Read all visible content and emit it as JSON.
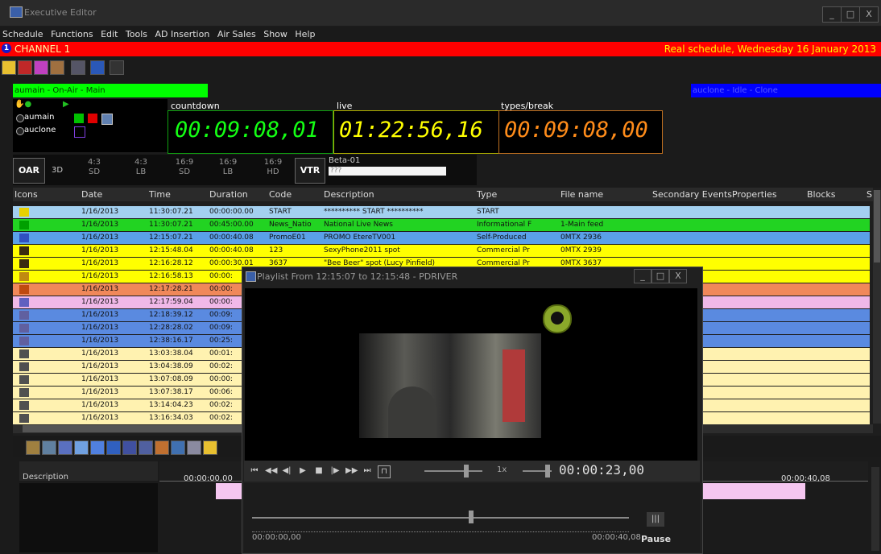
{
  "window": {
    "title": "Executive Editor",
    "min": "_",
    "max": "□",
    "close": "X"
  },
  "menu": [
    "Schedule",
    "Functions",
    "Edit",
    "Tools",
    "AD Insertion",
    "Air Sales",
    "Show",
    "Help"
  ],
  "channel": {
    "number": "1",
    "name": "CHANNEL 1",
    "status": "Real schedule, Wednesday 16 January 2013"
  },
  "servers": {
    "onair": "aumain - On-Air - Main",
    "backup": "auclone - Idle - Clone",
    "items": [
      "aumain",
      "auclone"
    ]
  },
  "clocks": {
    "countdown_label": "countdown",
    "countdown": "00:09:08,01",
    "live_label": "live",
    "live": "01:22:56,16",
    "types_label": "types/break",
    "types": "00:09:08,00"
  },
  "modes": {
    "oar": "OAR",
    "three_d": "3D",
    "m1": "4:3",
    "m1s": "SD",
    "m2": "4:3",
    "m2s": "LB",
    "m3": "16:9",
    "m3s": "SD",
    "m4": "16:9",
    "m4s": "LB",
    "m5": "16:9",
    "m5s": "HD",
    "vtr": "VTR",
    "beta": "Beta-01",
    "beta_field": "???"
  },
  "columns": [
    "Icons",
    "Date",
    "Time",
    "Duration",
    "Code",
    "Description",
    "Type",
    "File name",
    "Secondary Events",
    "Properties",
    "Blocks",
    "S"
  ],
  "rows": [
    {
      "date": "1/16/2013",
      "time": "11:30:07.21",
      "dur": "00:00:00.00",
      "code": "START",
      "desc": "********** START **********",
      "type": "START",
      "file": "",
      "bg": "#a3d0f0"
    },
    {
      "date": "1/16/2013",
      "time": "11:30:07.21",
      "dur": "00:45:00.00",
      "code": "News_Natio",
      "desc": "National Live News",
      "type": "Informational F",
      "file": "1-Main feed",
      "bg": "#22d322"
    },
    {
      "date": "1/16/2013",
      "time": "12:15:07.21",
      "dur": "00:00:40.08",
      "code": "PromoE01",
      "desc": "PROMO EtereTV001",
      "type": "Self-Produced",
      "file": "0MTX    2936",
      "bg": "#5aa0e8"
    },
    {
      "date": "1/16/2013",
      "time": "12:15:48.04",
      "dur": "00:00:40.08",
      "code": "123",
      "desc": "SexyPhone2011 spot",
      "type": "Commercial Pr",
      "file": "0MTX    2939",
      "bg": "#ffff00"
    },
    {
      "date": "1/16/2013",
      "time": "12:16:28.12",
      "dur": "00:00:30.01",
      "code": "3637",
      "desc": "\"Bee Beer\" spot (Lucy Pinfield)",
      "type": "Commercial Pr",
      "file": "0MTX    3637",
      "bg": "#ffff00"
    },
    {
      "date": "1/16/2013",
      "time": "12:16:58.13",
      "dur": "00:00:",
      "code": "",
      "desc": "",
      "type": "",
      "file": "",
      "bg": "#ffff00"
    },
    {
      "date": "1/16/2013",
      "time": "12:17:28.21",
      "dur": "00:00:",
      "code": "",
      "desc": "",
      "type": "",
      "file": "",
      "bg": "#f0885a"
    },
    {
      "date": "1/16/2013",
      "time": "12:17:59.04",
      "dur": "00:00:",
      "code": "",
      "desc": "",
      "type": "",
      "file": "",
      "bg": "#f0b8e8"
    },
    {
      "date": "1/16/2013",
      "time": "12:18:39.12",
      "dur": "00:09:",
      "code": "",
      "desc": "",
      "type": "",
      "file": "",
      "bg": "#5a8ae0"
    },
    {
      "date": "1/16/2013",
      "time": "12:28:28.02",
      "dur": "00:09:",
      "code": "",
      "desc": "",
      "type": "",
      "file": "",
      "bg": "#5a8ae0"
    },
    {
      "date": "1/16/2013",
      "time": "12:38:16.17",
      "dur": "00:25:",
      "code": "",
      "desc": "",
      "type": "",
      "file": "",
      "bg": "#5a8ae0"
    },
    {
      "date": "1/16/2013",
      "time": "13:03:38.04",
      "dur": "00:01:",
      "code": "",
      "desc": "",
      "type": "",
      "file": "",
      "bg": "#fff2b0"
    },
    {
      "date": "1/16/2013",
      "time": "13:04:38.09",
      "dur": "00:02:",
      "code": "",
      "desc": "",
      "type": "",
      "file": "",
      "bg": "#fff2b0"
    },
    {
      "date": "1/16/2013",
      "time": "13:07:08.09",
      "dur": "00:00:",
      "code": "",
      "desc": "",
      "type": "",
      "file": "",
      "bg": "#fff2b0"
    },
    {
      "date": "1/16/2013",
      "time": "13:07:38.17",
      "dur": "00:06:",
      "code": "",
      "desc": "",
      "type": "",
      "file": "",
      "bg": "#fff2b0"
    },
    {
      "date": "1/16/2013",
      "time": "13:14:04.23",
      "dur": "00:02:",
      "code": "",
      "desc": "",
      "type": "",
      "file": "",
      "bg": "#fff2b0"
    },
    {
      "date": "1/16/2013",
      "time": "13:16:34.03",
      "dur": "00:02:",
      "code": "",
      "desc": "",
      "type": "",
      "file": "",
      "bg": "#fff2b0"
    }
  ],
  "timeline": {
    "desc_label": "Description",
    "t_left": "00:00:00,00",
    "t_right": "00:00:40,08"
  },
  "player": {
    "title": "Playlist From 12:15:07 to 12:15:48 - PDRIVER",
    "speed": "1x",
    "timecode": "00:00:23,00",
    "start": "00:00:00,00",
    "end": "00:00:40,08",
    "pause": "Pause"
  }
}
